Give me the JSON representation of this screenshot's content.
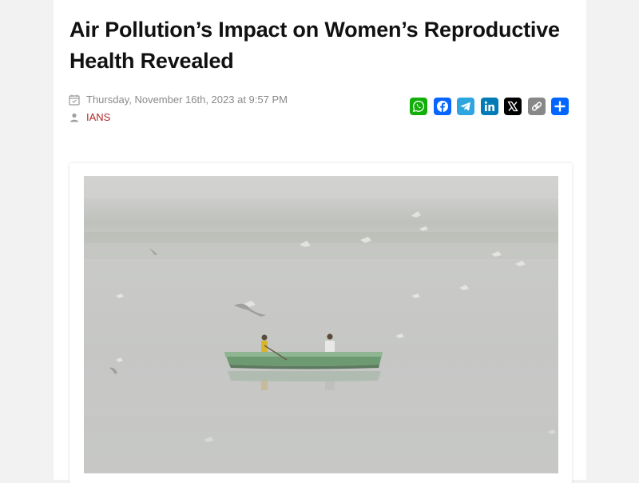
{
  "article": {
    "title": "Air Pollution’s Impact on Women’s Reproductive Health Revealed",
    "date": "Thursday, November 16th, 2023 at 9:57 PM",
    "author": "IANS"
  },
  "icons": {
    "date": "calendar-icon",
    "author": "user-icon"
  },
  "share": [
    {
      "name": "whatsapp",
      "icon": "whatsapp-icon",
      "color": "#12af0a"
    },
    {
      "name": "facebook",
      "icon": "facebook-icon",
      "color": "#0866ff"
    },
    {
      "name": "telegram",
      "icon": "telegram-icon",
      "color": "#2ca5e0"
    },
    {
      "name": "linkedin",
      "icon": "linkedin-icon",
      "color": "#007bb5"
    },
    {
      "name": "x",
      "icon": "x-icon",
      "color": "#000000"
    },
    {
      "name": "copy-link",
      "icon": "link-icon",
      "color": "#888888"
    },
    {
      "name": "share",
      "icon": "share-plus-icon",
      "color": "#0166ff"
    }
  ],
  "photo": {
    "subject": "smog-river-boat-photo"
  }
}
